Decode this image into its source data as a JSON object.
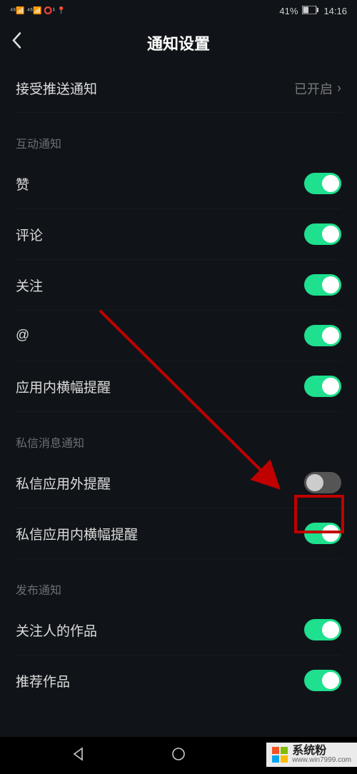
{
  "status_bar": {
    "left": "⁴⁶📶 ⁴⁶📶 ⭕¹ 📍",
    "battery_pct": "41%",
    "time": "14:16"
  },
  "header": {
    "title": "通知设置"
  },
  "push_row": {
    "label": "接受推送通知",
    "value": "已开启"
  },
  "section_interactive": {
    "title": "互动通知",
    "items": [
      {
        "label": "赞",
        "on": true
      },
      {
        "label": "评论",
        "on": true
      },
      {
        "label": "关注",
        "on": true
      },
      {
        "label": "@",
        "on": true
      },
      {
        "label": "应用内横幅提醒",
        "on": true
      }
    ]
  },
  "section_dm": {
    "title": "私信消息通知",
    "items": [
      {
        "label": "私信应用外提醒",
        "on": false
      },
      {
        "label": "私信应用内横幅提醒",
        "on": true
      }
    ]
  },
  "section_publish": {
    "title": "发布通知",
    "items": [
      {
        "label": "关注人的作品",
        "on": true
      },
      {
        "label": "推荐作品",
        "on": true
      }
    ]
  },
  "watermark": {
    "text": "系统粉",
    "url": "www.win7999.com"
  }
}
